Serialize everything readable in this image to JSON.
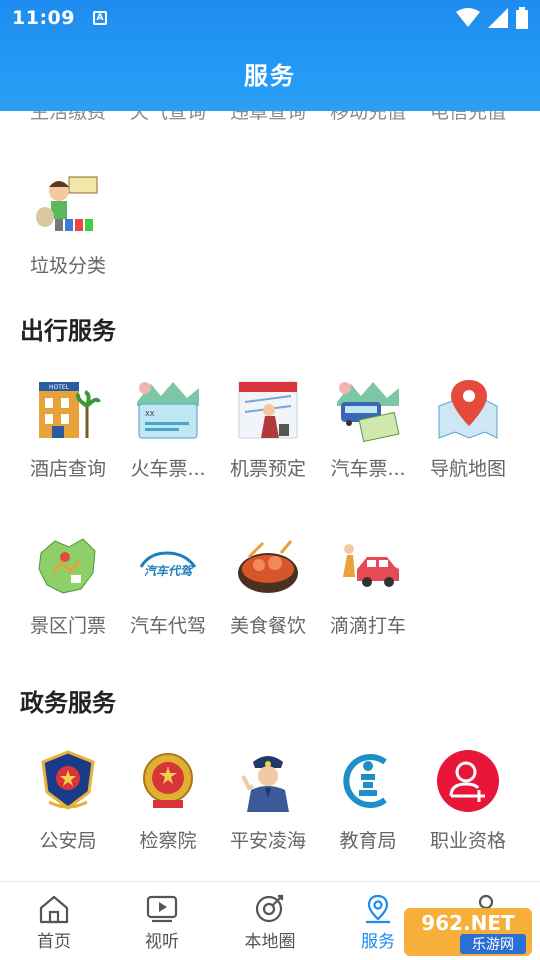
{
  "status": {
    "time": "11:09",
    "a_badge": "A"
  },
  "header": {
    "title": "服务"
  },
  "cut_row": [
    "生活缴费",
    "天气查询",
    "违章查询",
    "移动充值",
    "电信充值"
  ],
  "life_items": [
    {
      "label": "垃圾分类",
      "icon": "garbage-sorting-icon"
    }
  ],
  "travel": {
    "title": "出行服务",
    "items": [
      {
        "label": "酒店查询",
        "icon": "hotel-icon"
      },
      {
        "label": "火车票...",
        "icon": "train-ticket-icon"
      },
      {
        "label": "机票预定",
        "icon": "plane-ticket-icon"
      },
      {
        "label": "汽车票...",
        "icon": "bus-ticket-icon"
      },
      {
        "label": "导航地图",
        "icon": "map-pin-icon"
      },
      {
        "label": "景区门票",
        "icon": "scenic-map-icon"
      },
      {
        "label": "汽车代驾",
        "icon": "designated-driver-icon"
      },
      {
        "label": "美食餐饮",
        "icon": "food-icon"
      },
      {
        "label": "滴滴打车",
        "icon": "taxi-icon"
      }
    ]
  },
  "gov": {
    "title": "政务服务",
    "items": [
      {
        "label": "公安局",
        "icon": "police-badge-icon"
      },
      {
        "label": "检察院",
        "icon": "procuratorate-emblem-icon"
      },
      {
        "label": "平安凌海",
        "icon": "police-officer-icon"
      },
      {
        "label": "教育局",
        "icon": "education-bureau-icon"
      },
      {
        "label": "职业资格",
        "icon": "qualification-icon"
      }
    ]
  },
  "icon_text": {
    "hotel": "HOTEL",
    "driver": "汽车代驾"
  },
  "bottom_nav": [
    {
      "label": "首页",
      "icon": "home-icon"
    },
    {
      "label": "视听",
      "icon": "video-icon"
    },
    {
      "label": "本地圈",
      "icon": "local-circle-icon"
    },
    {
      "label": "服务",
      "icon": "location-pin-icon",
      "active": true
    },
    {
      "label": "",
      "icon": "user-icon"
    }
  ],
  "watermark": {
    "text": "962.NET",
    "sub": "乐游网"
  },
  "colors": {
    "primary": "#1d8cf0",
    "active_nav": "#1a8cf0",
    "red": "#e8173a"
  }
}
